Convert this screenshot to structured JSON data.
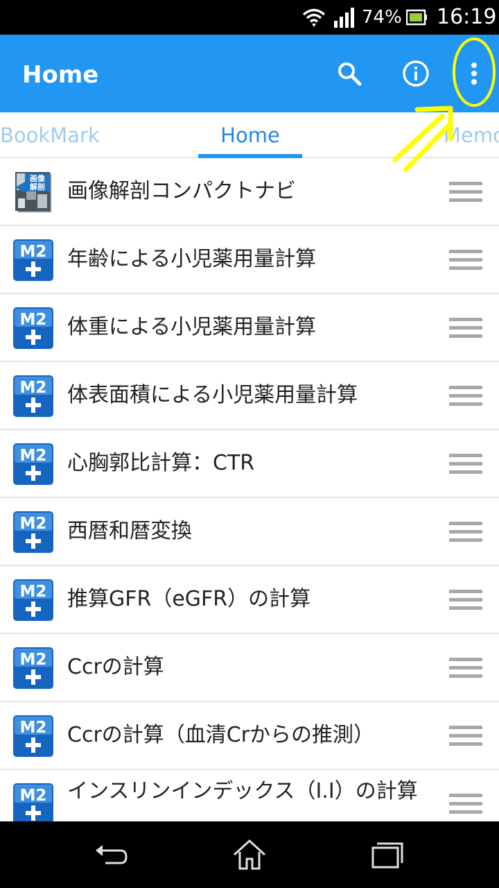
{
  "status_bar": {
    "battery_percent": "74%",
    "time": "16:19",
    "icons": [
      "wifi-icon",
      "signal-icon",
      "battery-icon"
    ]
  },
  "app_bar": {
    "title": "Home",
    "actions": [
      "search-icon",
      "info-icon",
      "more-vert-icon"
    ],
    "color": "#2196f3"
  },
  "tabs": {
    "items": [
      {
        "label": "BookMark"
      },
      {
        "label": "Home",
        "selected": true
      },
      {
        "label": "Memo"
      }
    ]
  },
  "list": {
    "items": [
      {
        "label": "画像解剖コンパクトナビ",
        "icon": "anatomy-book-icon",
        "icon_text": "画像解剖"
      },
      {
        "label": "年齢による小児薬用量計算",
        "icon": "m2-plus-icon"
      },
      {
        "label": "体重による小児薬用量計算",
        "icon": "m2-plus-icon"
      },
      {
        "label": "体表面積による小児薬用量計算",
        "icon": "m2-plus-icon"
      },
      {
        "label": "心胸郭比計算：CTR",
        "icon": "m2-plus-icon"
      },
      {
        "label": "西暦和暦変換",
        "icon": "m2-plus-icon"
      },
      {
        "label": "推算GFR（eGFR）の計算",
        "icon": "m2-plus-icon"
      },
      {
        "label": "Ccrの計算",
        "icon": "m2-plus-icon"
      },
      {
        "label": "Ccrの計算（血清Crからの推測）",
        "icon": "m2-plus-icon"
      },
      {
        "label": "インスリンインデックス（I.I）の計算",
        "icon": "m2-plus-icon"
      }
    ],
    "m2_icon_text": "M2"
  },
  "annotation": {
    "shapes": [
      "yellow-circle",
      "yellow-double-arrow"
    ],
    "color": "#ffff00"
  },
  "nav_bar": {
    "buttons": [
      "back-icon",
      "home-icon",
      "recents-icon"
    ]
  }
}
